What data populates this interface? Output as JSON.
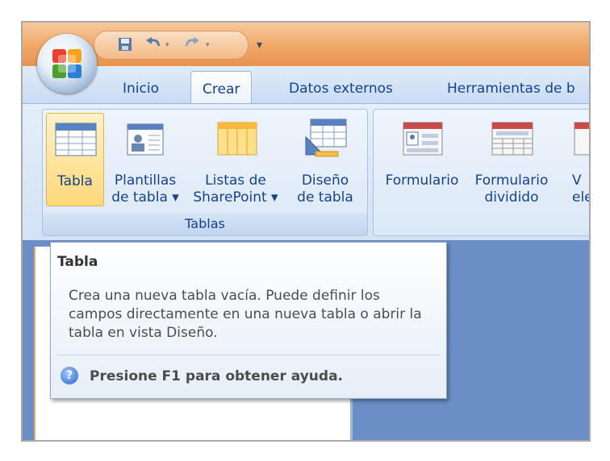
{
  "qat": {
    "save_icon": "save-icon",
    "undo_icon": "undo-icon",
    "redo_icon": "redo-icon",
    "customize_icon": "customize-qat-icon"
  },
  "tabs": [
    {
      "label": "Inicio"
    },
    {
      "label": "Crear",
      "active": true
    },
    {
      "label": "Datos externos"
    },
    {
      "label": "Herramientas de b"
    }
  ],
  "groups": {
    "tablas": {
      "label": "Tablas",
      "buttons": [
        {
          "line1": "Tabla",
          "line2": "",
          "icon": "table-icon",
          "selected": true
        },
        {
          "line1": "Plantillas",
          "line2": "de tabla ▾",
          "icon": "table-template-icon"
        },
        {
          "line1": "Listas de",
          "line2": "SharePoint ▾",
          "icon": "sharepoint-list-icon"
        },
        {
          "line1": "Diseño",
          "line2": "de tabla",
          "icon": "table-design-icon"
        }
      ]
    },
    "formularios": {
      "buttons": [
        {
          "line1": "Formulario",
          "line2": "",
          "icon": "form-icon"
        },
        {
          "line1": "Formulario",
          "line2": "dividido",
          "icon": "split-form-icon"
        },
        {
          "line1": "V",
          "line2": "ele",
          "icon": "multiple-items-icon"
        }
      ]
    }
  },
  "tooltip": {
    "title": "Tabla",
    "body": "Crea una nueva tabla vacía. Puede definir los campos directamente en una nueva tabla o abrir la tabla en vista Diseño.",
    "help": "Presione F1 para obtener ayuda.",
    "help_icon": "help-icon"
  },
  "colors": {
    "ribbon_text": "#15428b",
    "title_bar": "#f0a868",
    "work_area": "#6a8ec6"
  }
}
